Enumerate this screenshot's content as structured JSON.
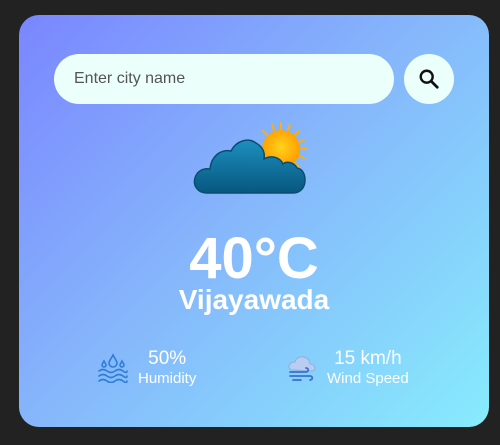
{
  "search": {
    "placeholder": "Enter city name",
    "button_icon": "search-icon"
  },
  "weather": {
    "icon": "cloud-sun-icon",
    "temperature": "40°C",
    "city": "Vijayawada"
  },
  "details": {
    "humidity": {
      "icon": "humidity-icon",
      "value": "50%",
      "label": "Humidity"
    },
    "wind": {
      "icon": "wind-icon",
      "value": "15 km/h",
      "label": "Wind Speed"
    }
  },
  "colors": {
    "page_background": "#222222",
    "card_gradient_start": "#7a86ff",
    "card_gradient_end": "#87ecfd",
    "input_background": "#ebfffb",
    "text": "#ffffff"
  }
}
